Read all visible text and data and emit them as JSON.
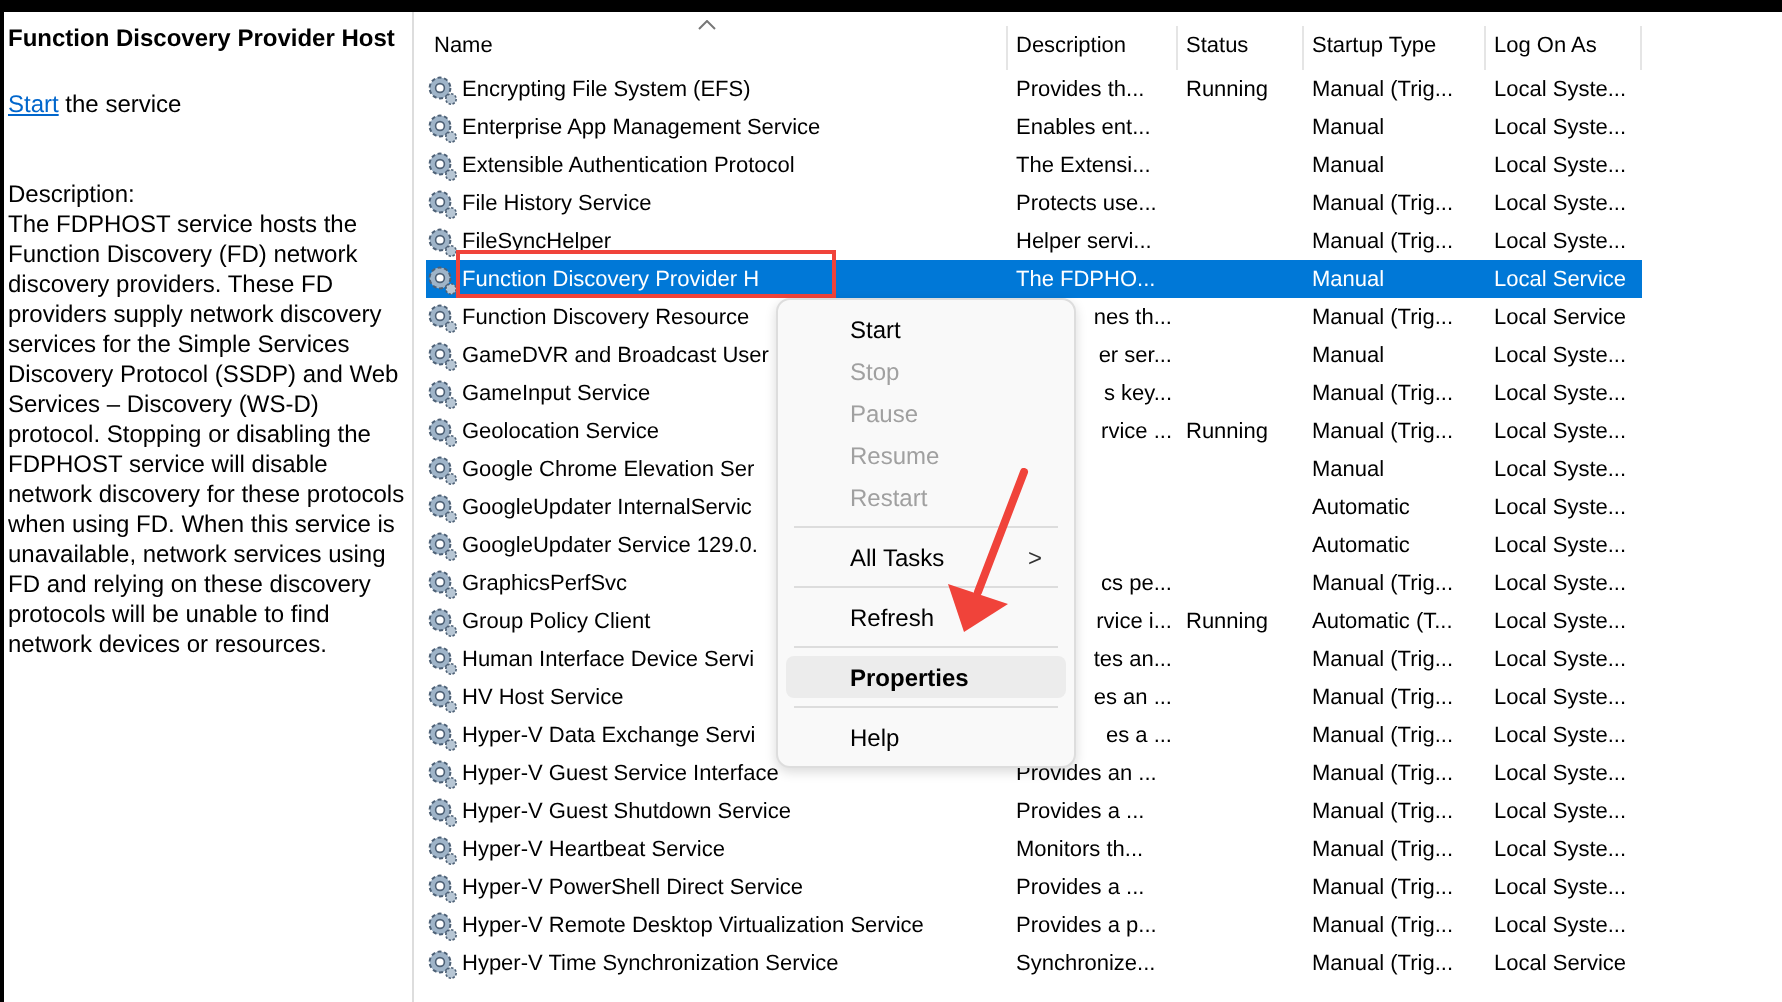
{
  "details": {
    "title": "Function Discovery Provider Host",
    "action_link": "Start",
    "action_text": " the service",
    "description_label": "Description:",
    "description": "The FDPHOST service hosts the Function Discovery (FD) network discovery providers. These FD providers supply network discovery services for the Simple Services Discovery Protocol (SSDP) and Web Services – Discovery (WS-D) protocol. Stopping or disabling the FDPHOST service will disable network discovery for these protocols when using FD. When this service is unavailable, network services using FD and relying on these discovery protocols will be unable to find network devices or resources."
  },
  "table": {
    "columns": [
      "Name",
      "Description",
      "Status",
      "Startup Type",
      "Log On As"
    ],
    "rows": [
      {
        "name": "Encrypting File System (EFS)",
        "description": "Provides th...",
        "status": "Running",
        "startup": "Manual (Trig...",
        "logon": "Local Syste...",
        "selected": false,
        "covered": false
      },
      {
        "name": "Enterprise App Management Service",
        "description": "Enables ent...",
        "status": "",
        "startup": "Manual",
        "logon": "Local Syste...",
        "selected": false,
        "covered": false
      },
      {
        "name": "Extensible Authentication Protocol",
        "description": "The Extensi...",
        "status": "",
        "startup": "Manual",
        "logon": "Local Syste...",
        "selected": false,
        "covered": false
      },
      {
        "name": "File History Service",
        "description": "Protects use...",
        "status": "",
        "startup": "Manual (Trig...",
        "logon": "Local Syste...",
        "selected": false,
        "covered": false
      },
      {
        "name": "FileSyncHelper",
        "description": "Helper servi...",
        "status": "",
        "startup": "Manual (Trig...",
        "logon": "Local Syste...",
        "selected": false,
        "covered": false
      },
      {
        "name": "Function Discovery Provider H",
        "description": "The FDPHO...",
        "status": "",
        "startup": "Manual",
        "logon": "Local Service",
        "selected": true,
        "covered": false
      },
      {
        "name": "Function Discovery Resource",
        "description": "nes th...",
        "status": "",
        "startup": "Manual (Trig...",
        "logon": "Local Service",
        "selected": false,
        "covered": true
      },
      {
        "name": "GameDVR and Broadcast User",
        "description": "er ser...",
        "status": "",
        "startup": "Manual",
        "logon": "Local Syste...",
        "selected": false,
        "covered": true
      },
      {
        "name": "GameInput Service",
        "description": "s key...",
        "status": "",
        "startup": "Manual (Trig...",
        "logon": "Local Syste...",
        "selected": false,
        "covered": true
      },
      {
        "name": "Geolocation Service",
        "description": "rvice ...",
        "status": "Running",
        "startup": "Manual (Trig...",
        "logon": "Local Syste...",
        "selected": false,
        "covered": true
      },
      {
        "name": "Google Chrome Elevation Ser",
        "description": "",
        "status": "",
        "startup": "Manual",
        "logon": "Local Syste...",
        "selected": false
      },
      {
        "name": "GoogleUpdater InternalServic",
        "description": "",
        "status": "",
        "startup": "Automatic",
        "logon": "Local Syste...",
        "selected": false
      },
      {
        "name": "GoogleUpdater Service 129.0.",
        "description": "",
        "status": "",
        "startup": "Automatic",
        "logon": "Local Syste...",
        "selected": false
      },
      {
        "name": "GraphicsPerfSvc",
        "description": "cs pe...",
        "status": "",
        "startup": "Manual (Trig...",
        "logon": "Local Syste...",
        "selected": false,
        "covered": true
      },
      {
        "name": "Group Policy Client",
        "description": "rvice i...",
        "status": "Running",
        "startup": "Automatic (T...",
        "logon": "Local Syste...",
        "selected": false,
        "covered": true
      },
      {
        "name": "Human Interface Device Servi",
        "description": "tes an...",
        "status": "",
        "startup": "Manual (Trig...",
        "logon": "Local Syste...",
        "selected": false,
        "covered": true
      },
      {
        "name": "HV Host Service",
        "description": "es an ...",
        "status": "",
        "startup": "Manual (Trig...",
        "logon": "Local Syste...",
        "selected": false,
        "covered": true
      },
      {
        "name": "Hyper-V Data Exchange Servi",
        "description": "es a ...",
        "status": "",
        "startup": "Manual (Trig...",
        "logon": "Local Syste...",
        "selected": false,
        "covered": true
      },
      {
        "name": "Hyper-V Guest Service Interface",
        "description": "Provides an ...",
        "status": "",
        "startup": "Manual (Trig...",
        "logon": "Local Syste...",
        "selected": false,
        "covered": false
      },
      {
        "name": "Hyper-V Guest Shutdown Service",
        "description": "Provides a ...",
        "status": "",
        "startup": "Manual (Trig...",
        "logon": "Local Syste...",
        "selected": false,
        "covered": false
      },
      {
        "name": "Hyper-V Heartbeat Service",
        "description": "Monitors th...",
        "status": "",
        "startup": "Manual (Trig...",
        "logon": "Local Syste...",
        "selected": false,
        "covered": false
      },
      {
        "name": "Hyper-V PowerShell Direct Service",
        "description": "Provides a ...",
        "status": "",
        "startup": "Manual (Trig...",
        "logon": "Local Syste...",
        "selected": false,
        "covered": false
      },
      {
        "name": "Hyper-V Remote Desktop Virtualization Service",
        "description": "Provides a p...",
        "status": "",
        "startup": "Manual (Trig...",
        "logon": "Local Syste...",
        "selected": false,
        "covered": false
      },
      {
        "name": "Hyper-V Time Synchronization Service",
        "description": "Synchronize...",
        "status": "",
        "startup": "Manual (Trig...",
        "logon": "Local Service",
        "selected": false,
        "covered": false
      }
    ]
  },
  "context_menu": {
    "items": [
      {
        "kind": "item",
        "label": "Start",
        "disabled": false,
        "selected": false
      },
      {
        "kind": "item",
        "label": "Stop",
        "disabled": true,
        "selected": false
      },
      {
        "kind": "item",
        "label": "Pause",
        "disabled": true,
        "selected": false
      },
      {
        "kind": "item",
        "label": "Resume",
        "disabled": true,
        "selected": false
      },
      {
        "kind": "item",
        "label": "Restart",
        "disabled": true,
        "selected": false
      },
      {
        "kind": "separator"
      },
      {
        "kind": "submenu",
        "label": "All Tasks",
        "arrow": ">",
        "disabled": false,
        "selected": false
      },
      {
        "kind": "separator"
      },
      {
        "kind": "item",
        "label": "Refresh",
        "disabled": false,
        "selected": false
      },
      {
        "kind": "separator"
      },
      {
        "kind": "item",
        "label": "Properties",
        "disabled": false,
        "selected": true
      },
      {
        "kind": "separator"
      },
      {
        "kind": "item",
        "label": "Help",
        "disabled": false,
        "selected": false
      }
    ]
  }
}
